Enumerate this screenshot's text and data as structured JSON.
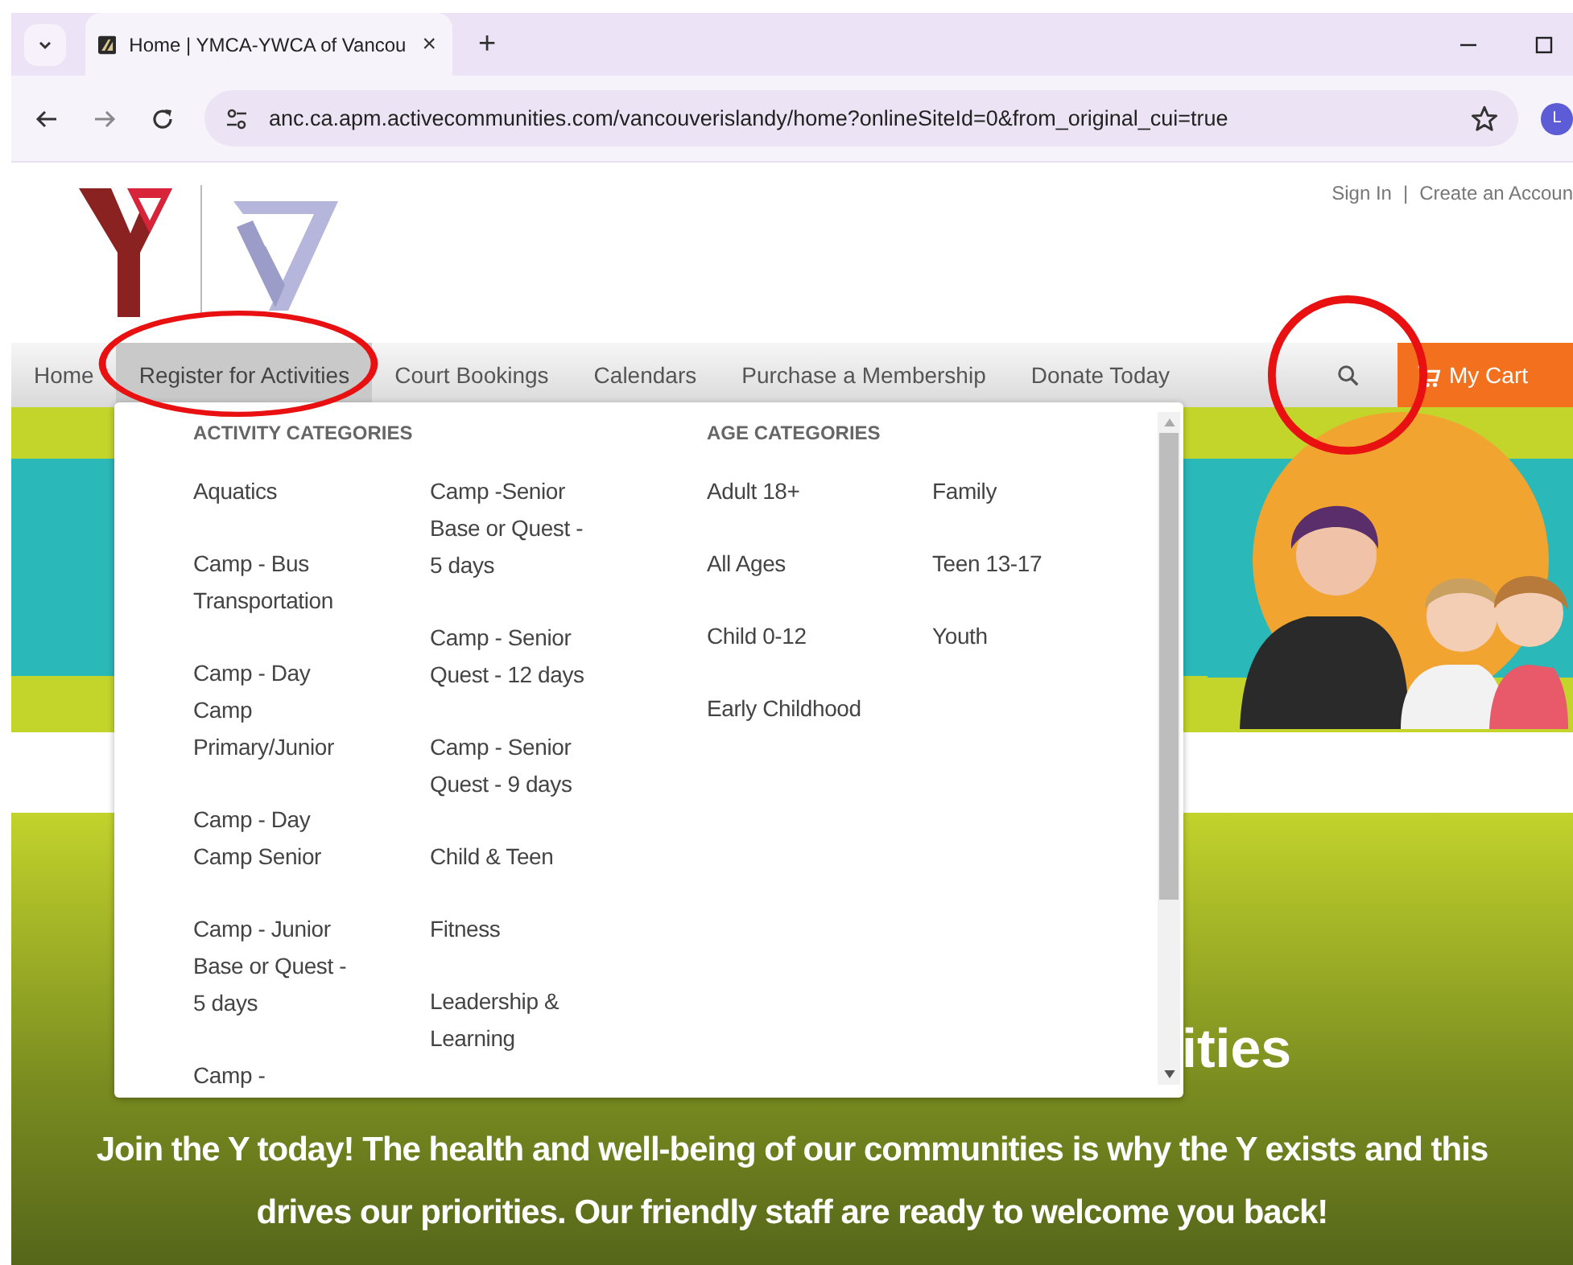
{
  "browser": {
    "tabs": [
      {
        "title": "Home | YMCA-YWCA of Vancou",
        "close": "×",
        "selected": true
      }
    ],
    "new_tab": "+",
    "url": "anc.ca.apm.activecommunities.com/vancouverislandy/home?onlineSiteId=0&from_original_cui=true",
    "profile_initial": "L"
  },
  "header": {
    "links": [
      {
        "label": "Sign In"
      },
      {
        "label": "Create an Accoun"
      }
    ],
    "separator": "|"
  },
  "nav": {
    "items": [
      {
        "label": "Home",
        "selected": false,
        "circled": false
      },
      {
        "label": "Register for Activities",
        "selected": true,
        "circled": true
      },
      {
        "label": "Court Bookings",
        "selected": false,
        "circled": false
      },
      {
        "label": "Calendars",
        "selected": false,
        "circled": false
      },
      {
        "label": "Purchase a Membership",
        "selected": false,
        "circled": false
      },
      {
        "label": "Donate Today",
        "selected": false,
        "circled": false
      }
    ],
    "search_circled": true,
    "cart": "My Cart"
  },
  "dropdown": {
    "groups": [
      {
        "heading": "ACTIVITY CATEGORIES",
        "columns": [
          [
            "Aquatics",
            "Camp - Bus Transportation",
            "Camp - Day Camp Primary/Junior",
            "Camp - Day Camp Senior",
            "Camp - Junior Base or Quest - 5 days",
            "Camp -"
          ],
          [
            "Camp -Senior Base or Quest - 5 days",
            "Camp - Senior Quest - 12 days",
            "Camp - Senior Quest - 9 days",
            "Child & Teen",
            "Fitness",
            "Leadership & Learning"
          ]
        ]
      },
      {
        "heading": "AGE CATEGORIES",
        "columns": [
          [
            "Adult 18+",
            "All Ages",
            "Child 0-12",
            "Early Childhood"
          ],
          [
            "Family",
            "Teen 13-17",
            "Youth"
          ]
        ]
      }
    ]
  },
  "banner": {
    "heading_fragment": "ities",
    "text": "Join the Y today! The health and well-being of our communities is why the Y exists and this drives our priorities. Our friendly staff are ready to welcome you back!"
  }
}
